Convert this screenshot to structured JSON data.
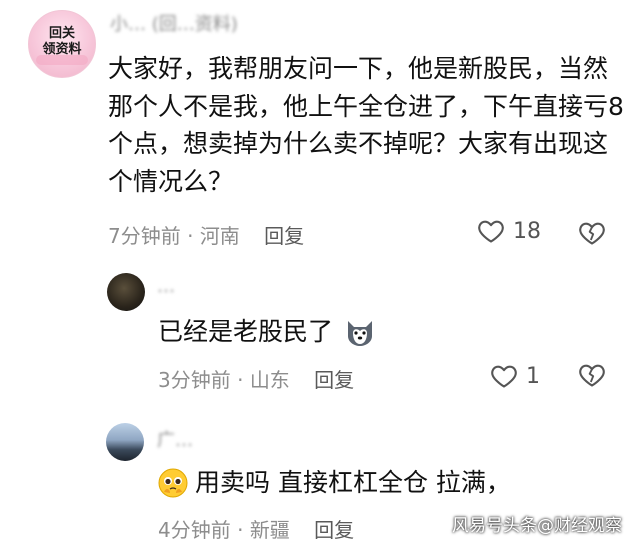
{
  "comments": [
    {
      "avatar_text_line1": "回关",
      "avatar_text_line2": "领资料",
      "author": "小… (回…资料)",
      "text": "大家好，我帮朋友问一下，他是新股民，当然那个人不是我，他上午全仓进了，下午直接亏8个点，想卖掉为什么卖不掉呢？大家有出现这个情况么？",
      "time": "7分钟前",
      "location": "河南",
      "reply_label": "回复",
      "like_count": "18"
    },
    {
      "author": "…",
      "text": "已经是老股民了",
      "time": "3分钟前",
      "location": "山东",
      "reply_label": "回复",
      "like_count": "1"
    },
    {
      "author": "广…",
      "text": "用卖吗 直接杠杠全仓 拉满，",
      "time": "4分钟前",
      "location": "新疆",
      "reply_label": "回复"
    }
  ],
  "watermark": "风易号头条@财经观察",
  "icons": {
    "like": "heart-outline-icon",
    "dislike": "broken-heart-icon",
    "emoji_reply2": "husky-dog-emoji",
    "emoji_reply3": "pleading-face-emoji"
  },
  "colors": {
    "meta_text": "#8d8d8d",
    "body_text": "#111111"
  }
}
